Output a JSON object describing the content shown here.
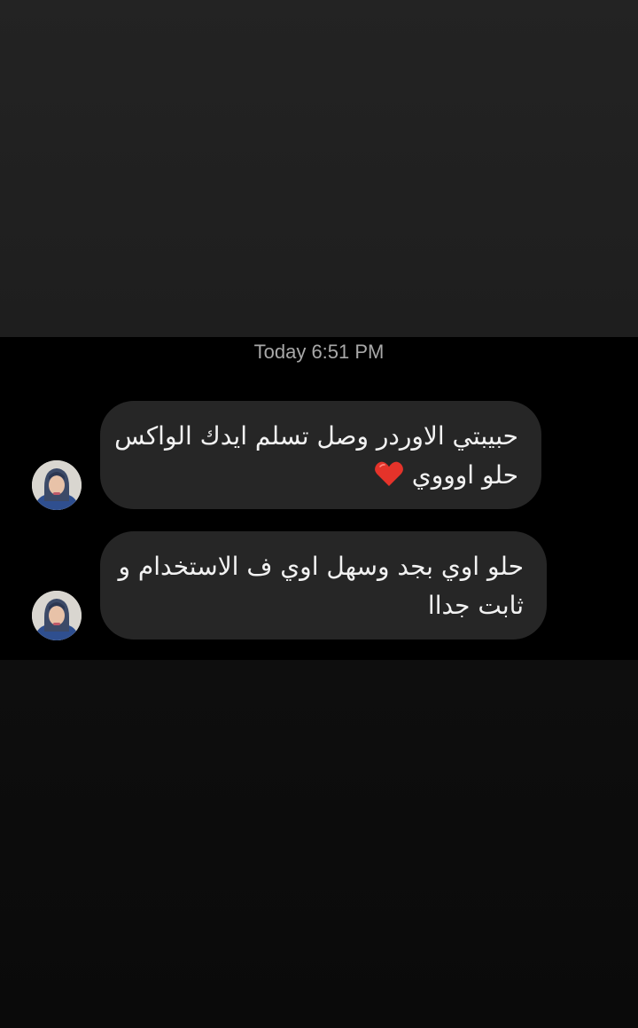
{
  "timestamp": "Today 6:51 PM",
  "messages": [
    {
      "line1": "حبيبتي الاوردر وصل تسلم ايدك الواكس",
      "line2": "حلو اوووي",
      "emoji": "red-heart"
    },
    {
      "line1": "حلو اوي بجد وسهل اوي ف الاستخدام و",
      "line2": "ثابت جداا"
    }
  ],
  "colors": {
    "bubble": "#262626",
    "heart": "#e5332a",
    "timestamp": "#a8a8a8"
  }
}
